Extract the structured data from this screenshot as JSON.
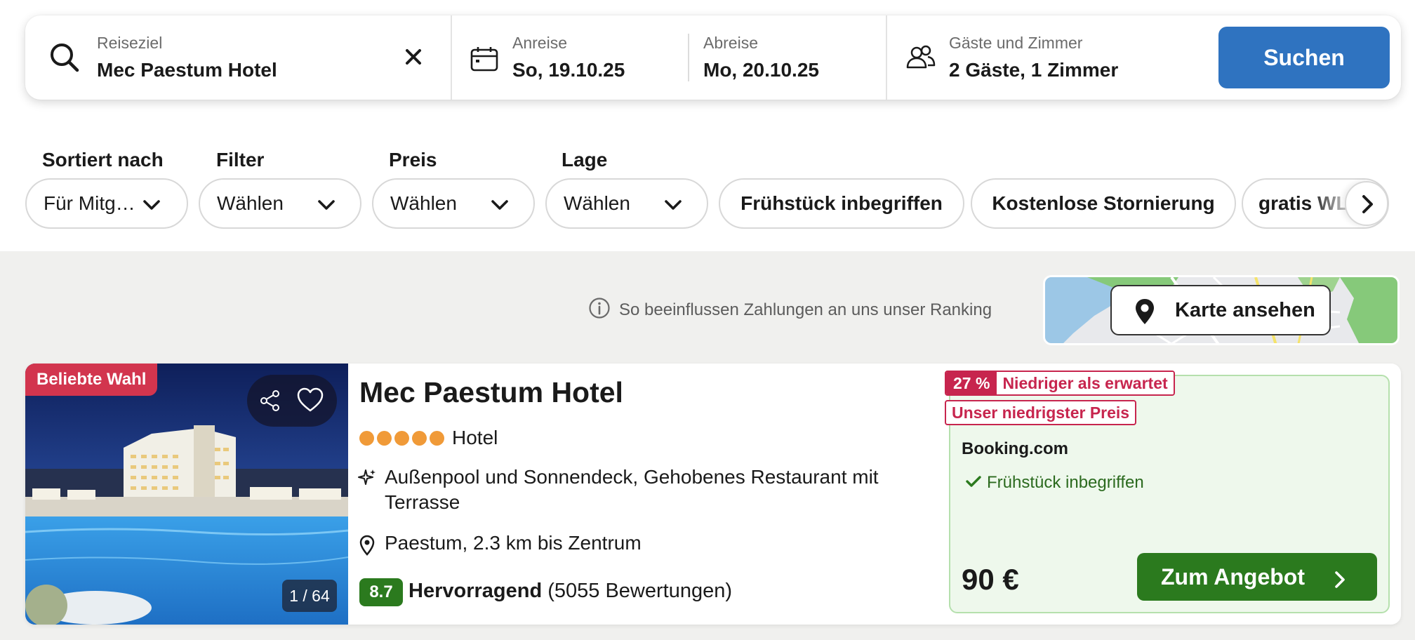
{
  "search": {
    "destination_label": "Reiseziel",
    "destination_value": "Mec Paestum Hotel",
    "checkin_label": "Anreise",
    "checkin_value": "So, 19.10.25",
    "checkout_label": "Abreise",
    "checkout_value": "Mo, 20.10.25",
    "guests_label": "Gäste und Zimmer",
    "guests_value": "2 Gäste, 1 Zimmer",
    "search_button": "Suchen"
  },
  "filters": {
    "sort_label": "Sortiert nach",
    "sort_value": "Für Mitg…",
    "filter_label": "Filter",
    "filter_value": "Wählen",
    "price_label": "Preis",
    "price_value": "Wählen",
    "location_label": "Lage",
    "location_value": "Wählen",
    "chips": [
      "Frühstück inbegriffen",
      "Kostenlose Stornierung",
      "gratis WLAN"
    ]
  },
  "ranking_info": "So beeinflussen Zahlungen an uns unser Ranking",
  "map_button": "Karte ansehen",
  "hotel": {
    "badge": "Beliebte Wahl",
    "photo_counter": "1 / 64",
    "name": "Mec Paestum Hotel",
    "stars": 5,
    "type": "Hotel",
    "features": "Außenpool und Sonnendeck, Gehobenes Restaurant mit Terrasse",
    "location": "Paestum, 2.3 km bis Zentrum",
    "rating_score": "8.7",
    "rating_word": "Hervorragend",
    "rating_count": "(5055 Bewertungen)"
  },
  "deal": {
    "discount_pct": "27 %",
    "discount_text": "Niedriger als erwartet",
    "lowest_price_tag": "Unser niedrigster Preis",
    "provider": "Booking.com",
    "breakfast": "Frühstück inbegriffen",
    "price": "90 €",
    "offer_button": "Zum Angebot"
  },
  "colors": {
    "primary_blue": "#2f73c0",
    "offer_green": "#2b7a1e",
    "deal_red": "#c7254e",
    "badge_pink": "#d2354e",
    "star_orange": "#f09a38"
  }
}
